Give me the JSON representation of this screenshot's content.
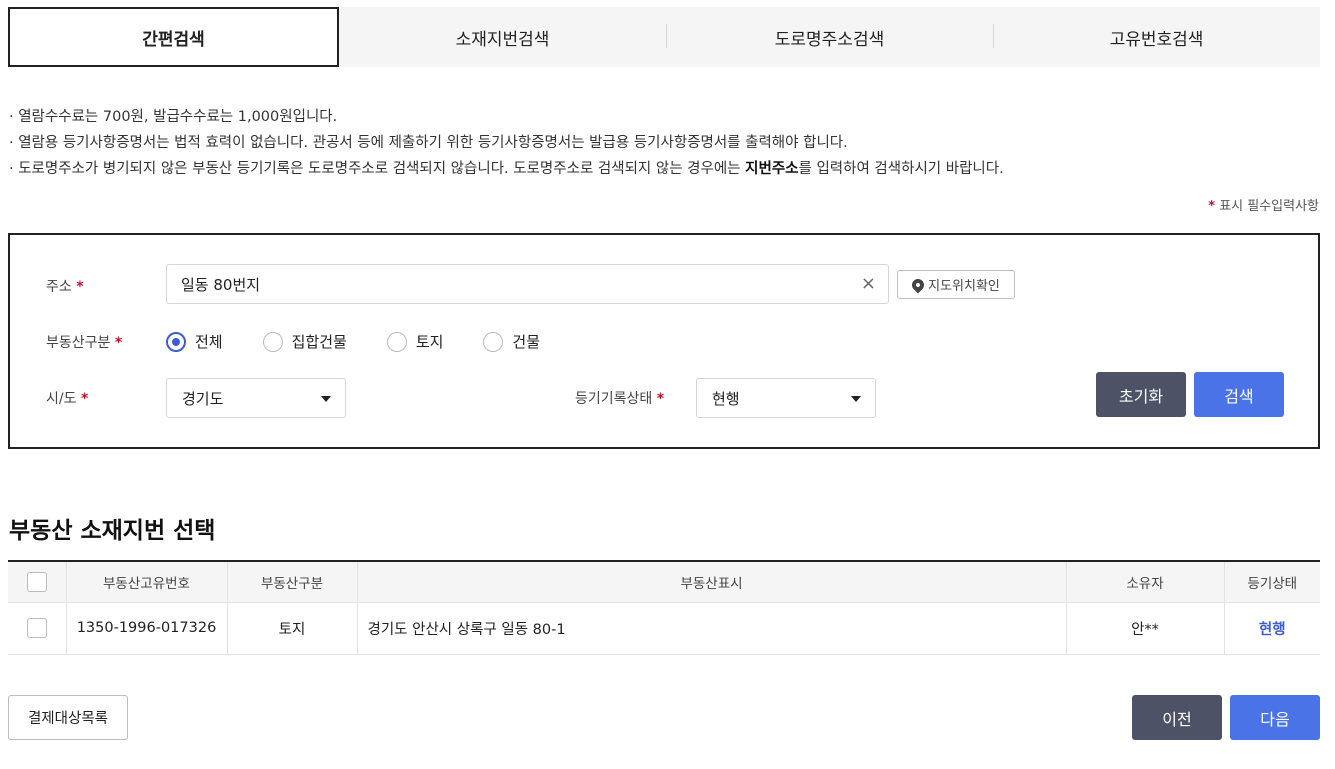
{
  "tabs": [
    {
      "label": "간편검색",
      "active": true
    },
    {
      "label": "소재지번검색",
      "active": false
    },
    {
      "label": "도로명주소검색",
      "active": false
    },
    {
      "label": "고유번호검색",
      "active": false
    }
  ],
  "notes": {
    "line1": "· 열람수수료는  700원, 발급수수료는  1,000원입니다.",
    "line2": "· 열람용 등기사항증명서는 법적 효력이 없습니다. 관공서 등에 제출하기 위한 등기사항증명서는 발급용 등기사항증명서를 출력해야 합니다.",
    "line3_pre": "· 도로명주소가 병기되지 않은 부동산 등기기록은 도로명주소로 검색되지 않습니다. 도로명주소로 검색되지 않는 경우에는 ",
    "line3_bold": "지번주소",
    "line3_post": "를 입력하여 검색하시기 바랍니다."
  },
  "required_note": {
    "star": "*",
    "text": "표시 필수입력사항"
  },
  "form": {
    "address_label": "주소",
    "address_value": "일동 80번지",
    "clear_icon": "×",
    "map_button": "지도위치확인",
    "type_label": "부동산구분",
    "type_options": [
      "전체",
      "집합건물",
      "토지",
      "건물"
    ],
    "type_selected": "전체",
    "sido_label": "시/도",
    "sido_value": "경기도",
    "status_label": "등기기록상태",
    "status_value": "현행",
    "reset_button": "초기화",
    "search_button": "검색",
    "required_mark": "*"
  },
  "result": {
    "title": "부동산 소재지번 선택",
    "columns": [
      "부동산고유번호",
      "부동산구분",
      "부동산표시",
      "소유자",
      "등기상태"
    ],
    "rows": [
      {
        "id": "1350-1996-017326",
        "type": "토지",
        "address": "경기도 안산시 상록구 일동 80-1",
        "owner": "안**",
        "status": "현행"
      }
    ]
  },
  "footer": {
    "cart_button": "결제대상목록",
    "prev_button": "이전",
    "next_button": "다음"
  },
  "colors": {
    "accent_blue": "#4a73e8",
    "dark_button": "#4e5266",
    "required_red": "#c8102e",
    "status_blue": "#3e5bd6"
  }
}
